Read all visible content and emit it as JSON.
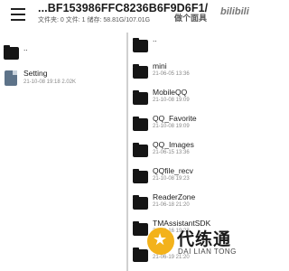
{
  "header": {
    "title": "...BF153986FFC8236B6F9D6F1/",
    "subtitle": "文件夹: 0  文件: 1  储存: 58.81G/107.01G",
    "watermark_text": "做个面具",
    "bili_text": "bilibili"
  },
  "left_pane": {
    "items": [
      {
        "kind": "folder",
        "name": "..",
        "meta": ""
      },
      {
        "kind": "file",
        "name": "Setting",
        "meta": "21-10-08 19:18  2.02K"
      }
    ]
  },
  "right_pane": {
    "items": [
      {
        "kind": "folder",
        "name": "..",
        "meta": ""
      },
      {
        "kind": "folder",
        "name": "mini",
        "meta": "21-06-05 13:36"
      },
      {
        "kind": "folder",
        "name": "MobileQQ",
        "meta": "21-10-08 19:09"
      },
      {
        "kind": "folder",
        "name": "QQ_Favorite",
        "meta": "21-10-08 19:09"
      },
      {
        "kind": "folder",
        "name": "QQ_Images",
        "meta": "21-06-15 13:36"
      },
      {
        "kind": "folder",
        "name": "QQfile_recv",
        "meta": "21-10-08 19:23"
      },
      {
        "kind": "folder",
        "name": "ReaderZone",
        "meta": "21-06-18 21:20"
      },
      {
        "kind": "folder",
        "name": "TMAssistantSDK",
        "meta": "21-06-16 19:28"
      },
      {
        "kind": "folder",
        "name": "",
        "meta": "21-06-19 21:20"
      }
    ]
  },
  "overlay_logo": {
    "cn_text": "代练通",
    "en_text": "DAI LIAN TONG"
  }
}
